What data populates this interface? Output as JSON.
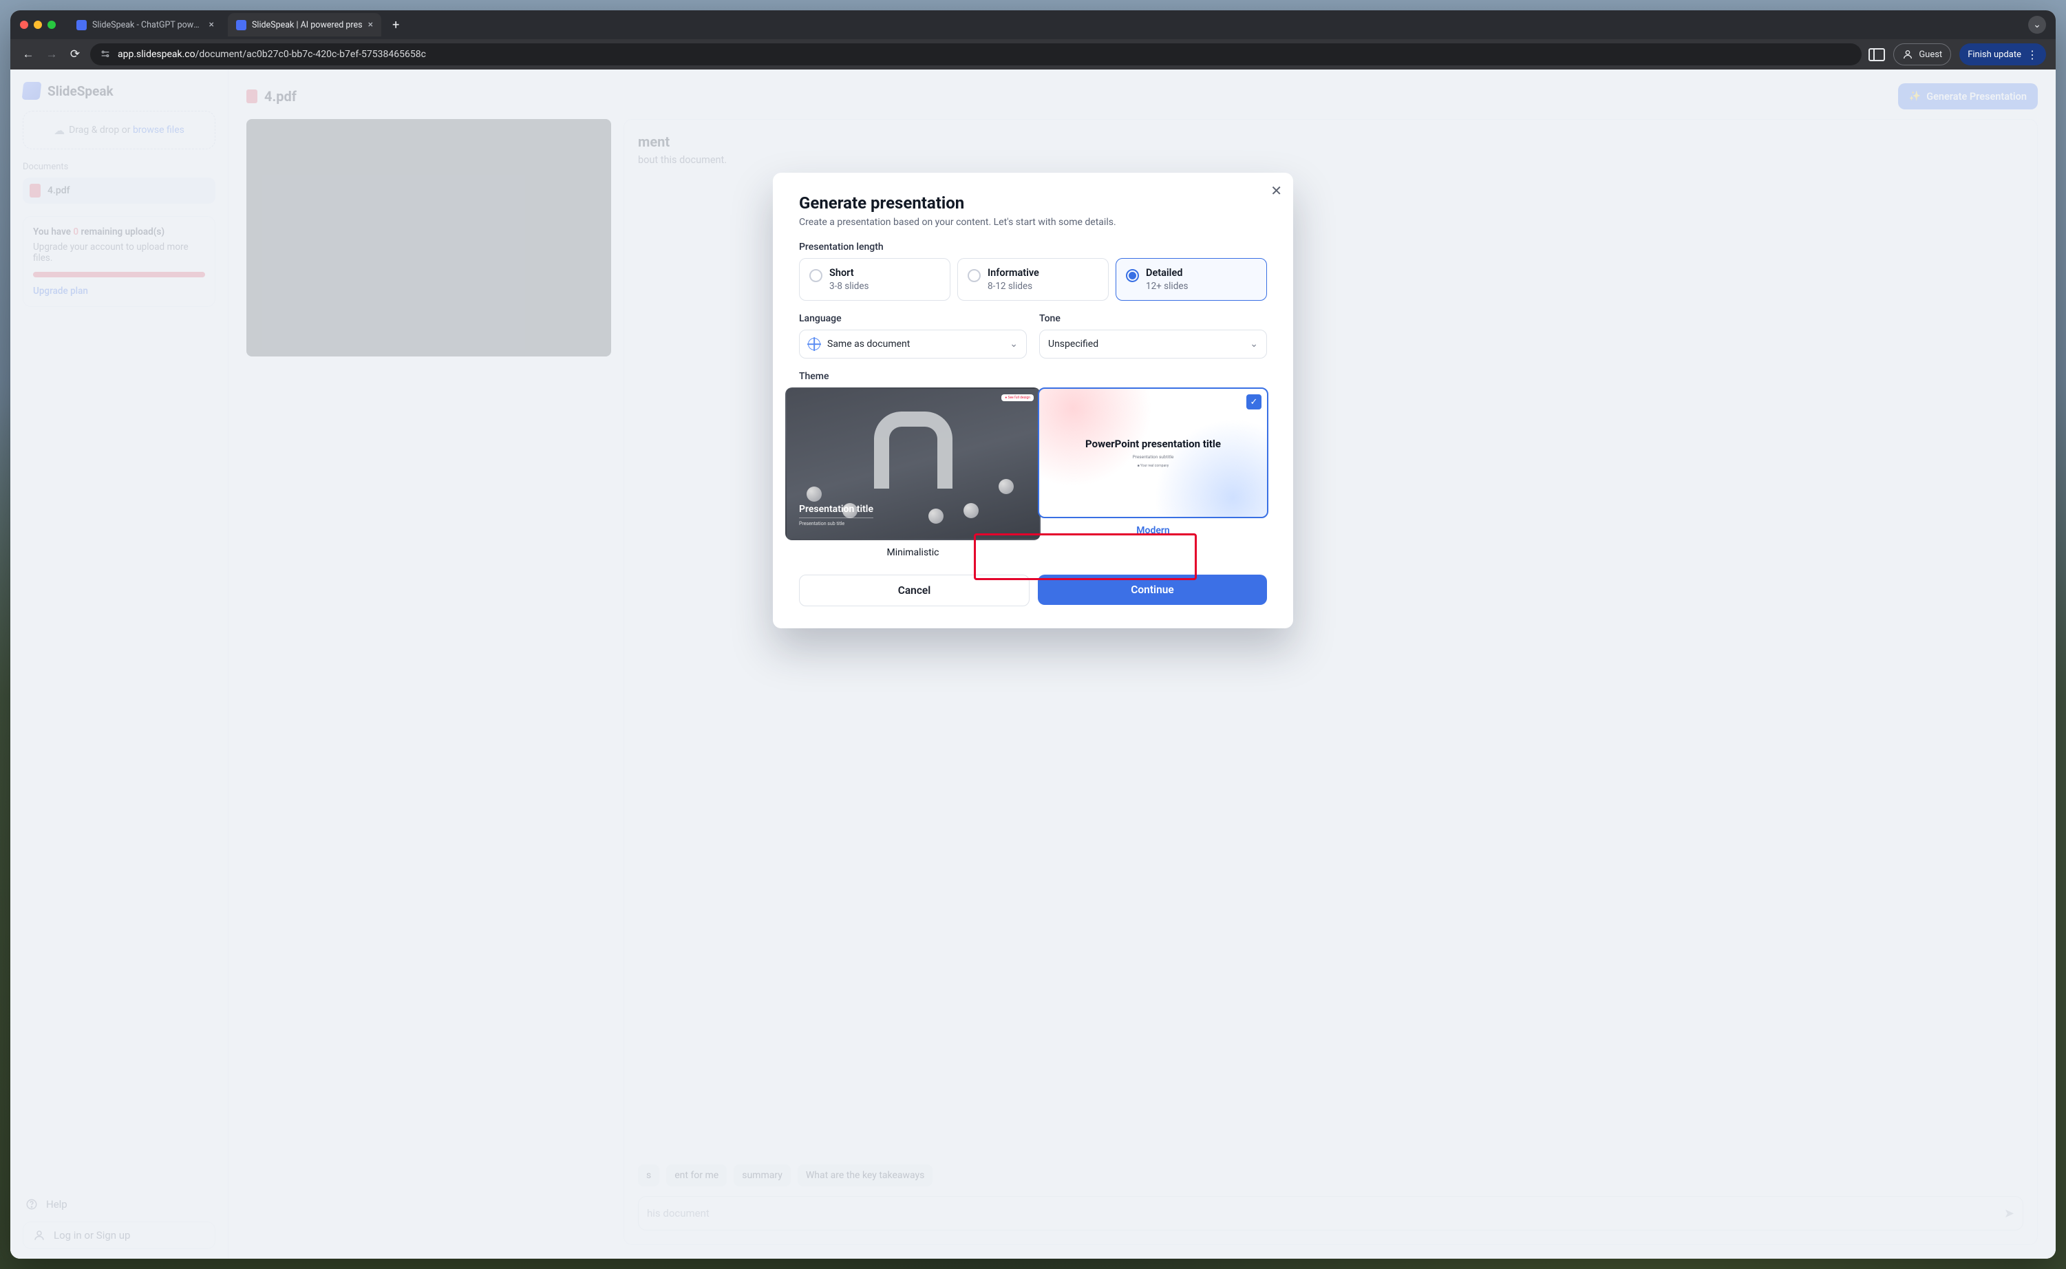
{
  "browser": {
    "tabs": [
      {
        "title": "SlideSpeak - ChatGPT powere",
        "active": false
      },
      {
        "title": "SlideSpeak | AI powered pres",
        "active": true
      }
    ],
    "url_prefix": "app.slidespeak.co",
    "url_rest": "/document/ac0b27c0-bb7c-420c-b7ef-57538465658c",
    "guest_label": "Guest",
    "finish_label": "Finish update"
  },
  "sidebar": {
    "brand": "SlideSpeak",
    "upload_pre": "Drag & drop or ",
    "upload_link": "browse files",
    "documents_label": "Documents",
    "doc_name": "4.pdf",
    "quota_line_pre": "You have ",
    "quota_zero": "0",
    "quota_line_post": " remaining upload(s)",
    "quota_sub": "Upgrade your account to upload more files.",
    "upgrade_link": "Upgrade plan",
    "help": "Help",
    "login": "Log in or Sign up"
  },
  "main": {
    "file_name": "4.pdf",
    "generate_btn": "Generate Presentation",
    "convo_title_suffix": "ment",
    "convo_sub_suffix": "bout this document.",
    "chips": [
      "s",
      "ent for me",
      " summary",
      "What are the key takeaways"
    ],
    "ask_placeholder_suffix": "his document",
    "send_icon": "send-icon"
  },
  "modal": {
    "title": "Generate presentation",
    "subtitle": "Create a presentation based on your content. Let's start with some details.",
    "length_label": "Presentation length",
    "lengths": [
      {
        "title": "Short",
        "sub": "3-8 slides"
      },
      {
        "title": "Informative",
        "sub": "8-12 slides"
      },
      {
        "title": "Detailed",
        "sub": "12+ slides"
      }
    ],
    "language_label": "Language",
    "language_value": "Same as document",
    "tone_label": "Tone",
    "tone_value": "Unspecified",
    "theme_label": "Theme",
    "themes": [
      {
        "name": "Minimalistic",
        "preview_title": "Presentation title",
        "preview_sub": "Presentation sub title"
      },
      {
        "name": "Modern",
        "preview_title": "PowerPoint presentation title",
        "preview_sub": "Presentation subtitle"
      }
    ],
    "cancel": "Cancel",
    "continue": "Continue"
  }
}
